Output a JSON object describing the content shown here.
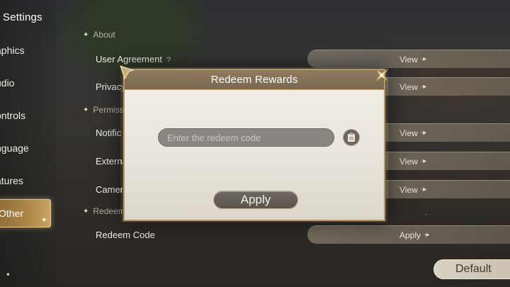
{
  "settings": {
    "title": "Settings"
  },
  "sidebar": {
    "items": [
      {
        "label": "aphics"
      },
      {
        "label": "udio"
      },
      {
        "label": "ontrols"
      },
      {
        "label": "nguage"
      },
      {
        "label": "atures"
      },
      {
        "label": "Other",
        "active": true
      }
    ]
  },
  "content": {
    "section_about": "About",
    "section_permissions": "Permiss",
    "section_redeem": "Redeem Code",
    "rows": [
      {
        "label": "User Agreement",
        "hint": "?",
        "button": "View"
      },
      {
        "label": "Privacy P",
        "button": "View"
      },
      {
        "label": "Notific",
        "button": "View"
      },
      {
        "label": "Externa",
        "button": "View"
      },
      {
        "label": "Camera",
        "button": "View"
      },
      {
        "label": "Redeem Code",
        "button": "Apply"
      }
    ],
    "default_label": "Default"
  },
  "modal": {
    "title": "Redeem Rewards",
    "input_placeholder": "Enter the redeem code",
    "input_value": "",
    "apply_label": "Apply"
  },
  "colors": {
    "accent_gold": "#b08a4a",
    "modal_bg": "#f2efe8",
    "modal_header": "#8f7a5f",
    "button_dark": "#5a554d"
  },
  "icons": {
    "close": "close-x-icon",
    "paste": "clipboard-icon",
    "row_arrow": "arrow-right-icon",
    "section_star": "star-icon"
  }
}
